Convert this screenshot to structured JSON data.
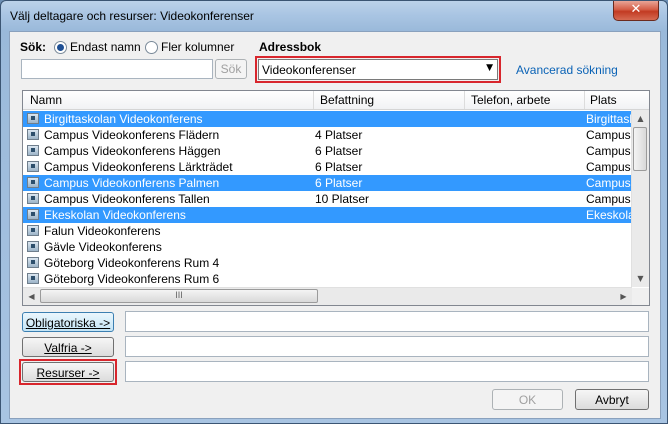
{
  "window": {
    "title": "Välj deltagare och resurser: Videokonferenser",
    "close_glyph": "✕"
  },
  "search": {
    "label": "Sök:",
    "option_name": "Endast namn",
    "option_columns": "Fler kolumner",
    "selected_option": "Endast namn",
    "input_value": "",
    "button_label": "Sök"
  },
  "addressbook": {
    "label": "Adressbok",
    "selected": "Videokonferenser",
    "advanced_link": "Avancerad sökning"
  },
  "list": {
    "columns": [
      "Namn",
      "Befattning",
      "Telefon, arbete",
      "Plats"
    ],
    "rows": [
      {
        "name": "Birgittaskolan Videokonferens",
        "title": "",
        "phone": "",
        "location": "Birgittaskolan",
        "selected": true
      },
      {
        "name": "Campus Videokonferens Flädern",
        "title": "4 Platser",
        "phone": "",
        "location": "Campus Skövde",
        "selected": false
      },
      {
        "name": "Campus Videokonferens Häggen",
        "title": "6 Platser",
        "phone": "",
        "location": "Campus Skövde",
        "selected": false
      },
      {
        "name": "Campus Videokonferens Lärkträdet",
        "title": "6 Platser",
        "phone": "",
        "location": "Campus Skövde",
        "selected": false
      },
      {
        "name": "Campus Videokonferens Palmen",
        "title": "6 Platser",
        "phone": "",
        "location": "Campus Skövde",
        "selected": true
      },
      {
        "name": "Campus Videokonferens Tallen",
        "title": "10 Platser",
        "phone": "",
        "location": "Campus Skövde",
        "selected": false
      },
      {
        "name": "Ekeskolan Videokonferens",
        "title": "",
        "phone": "",
        "location": "Ekeskolan",
        "selected": true
      },
      {
        "name": "Falun Videokonferens",
        "title": "",
        "phone": "",
        "location": "",
        "selected": false
      },
      {
        "name": "Gävle Videokonferens",
        "title": "",
        "phone": "",
        "location": "",
        "selected": false
      },
      {
        "name": "Göteborg Videokonferens Rum 4",
        "title": "",
        "phone": "",
        "location": "",
        "selected": false
      },
      {
        "name": "Göteborg Videokonferens Rum 6",
        "title": "",
        "phone": "",
        "location": "",
        "selected": false
      }
    ]
  },
  "recipients": {
    "required_label": "Obligatoriska ->",
    "optional_label": "Valfria ->",
    "resources_label": "Resurser ->",
    "required_value": "",
    "optional_value": "",
    "resources_value": ""
  },
  "footer": {
    "ok_label": "OK",
    "cancel_label": "Avbryt"
  },
  "icons": {
    "scroll_up": "▲",
    "scroll_down": "▼",
    "scroll_left": "◀",
    "scroll_right": "▶",
    "grip": "III"
  },
  "colors": {
    "selection": "#3399ff",
    "highlight": "#d8262d",
    "link": "#0b63b6"
  }
}
